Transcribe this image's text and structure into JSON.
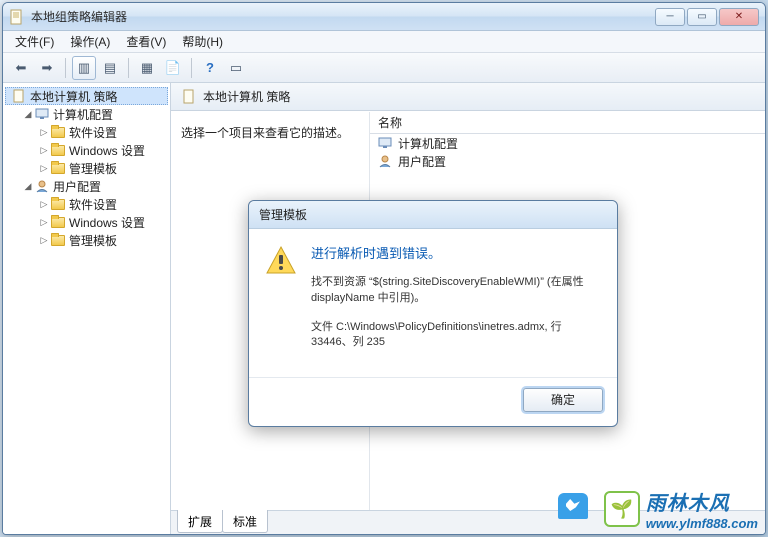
{
  "window": {
    "title": "本地组策略编辑器"
  },
  "menu": {
    "file": "文件(F)",
    "action": "操作(A)",
    "view": "查看(V)",
    "help": "帮助(H)"
  },
  "tree": {
    "root": "本地计算机 策略",
    "computer_config": "计算机配置",
    "software_settings": "软件设置",
    "windows_settings": "Windows 设置",
    "admin_templates": "管理模板",
    "user_config": "用户配置"
  },
  "rightpane": {
    "header": "本地计算机 策略",
    "desc": "选择一个项目来查看它的描述。",
    "col_name": "名称",
    "item_computer": "计算机配置",
    "item_user": "用户配置"
  },
  "tabs": {
    "extended": "扩展",
    "standard": "标准"
  },
  "dialog": {
    "title": "管理模板",
    "heading": "进行解析时遇到错误。",
    "para1": "找不到资源 “$(string.SiteDiscoveryEnableWMI)” (在属性 displayName 中引用)。",
    "para2": "文件 C:\\Windows\\PolicyDefinitions\\inetres.admx, 行 33446、列 235",
    "ok": "确定"
  },
  "watermark": {
    "cn": "雨林木风",
    "url": "www.ylmf888.com"
  }
}
